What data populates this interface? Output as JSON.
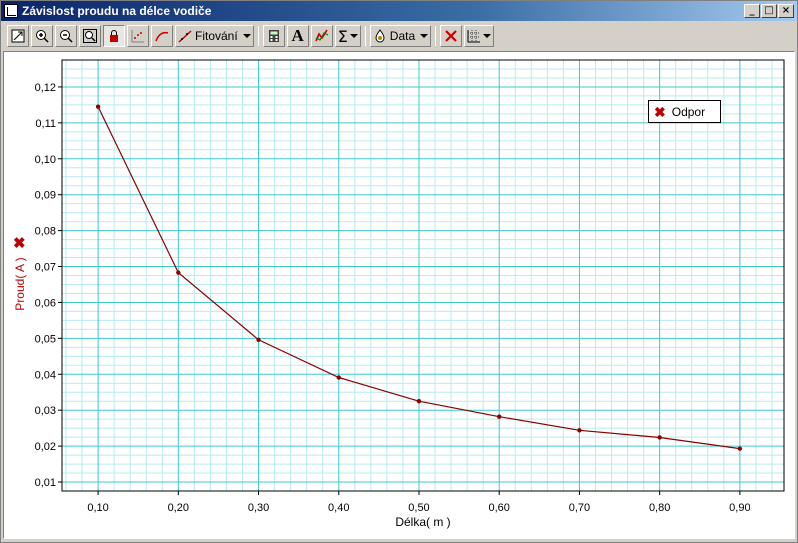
{
  "window": {
    "title": "Závislost proudu na délce vodiče",
    "buttons": {
      "minimize": "_",
      "maximize": "□",
      "close": "×"
    }
  },
  "toolbar": {
    "fit_label": "Fitování",
    "data_label": "Data",
    "sum_label": "Σ",
    "text_label": "A",
    "icons": [
      "resize-icon",
      "zoom-in-icon",
      "zoom-out-icon",
      "zoom-fit-icon",
      "lock-icon",
      "scatter-icon",
      "curve-icon",
      "fit-line-icon",
      "calculator-icon",
      "text-icon",
      "graph-icon",
      "sum-icon",
      "data-icon",
      "delete-icon",
      "grid-icon"
    ]
  },
  "chart_data": {
    "type": "line",
    "title": "",
    "xlabel": "Délka( m )",
    "ylabel": "Proud( A )",
    "xlim": [
      0.055,
      0.955
    ],
    "ylim": [
      0.0075,
      0.1275
    ],
    "xticks": [
      "0,10",
      "0,20",
      "0,30",
      "0,40",
      "0,50",
      "0,60",
      "0,70",
      "0,80",
      "0,90"
    ],
    "xtick_values": [
      0.1,
      0.2,
      0.3,
      0.4,
      0.5,
      0.6,
      0.7,
      0.8,
      0.9
    ],
    "yticks": [
      "0,01",
      "0,02",
      "0,03",
      "0,04",
      "0,05",
      "0,06",
      "0,07",
      "0,08",
      "0,09",
      "0,10",
      "0,11",
      "0,12"
    ],
    "ytick_values": [
      0.01,
      0.02,
      0.03,
      0.04,
      0.05,
      0.06,
      0.07,
      0.08,
      0.09,
      0.1,
      0.11,
      0.12
    ],
    "grid": true,
    "legend_position": "top-right",
    "series": [
      {
        "name": "Odpor",
        "color": "#8b0000",
        "x": [
          0.1,
          0.2,
          0.3,
          0.4,
          0.5,
          0.6,
          0.7,
          0.8,
          0.9
        ],
        "y": [
          0.1145,
          0.0683,
          0.0496,
          0.0391,
          0.0325,
          0.0282,
          0.0244,
          0.0224,
          0.0193
        ]
      }
    ],
    "colors": {
      "grid_major": "#40c8d0",
      "grid_minor": "#b8ecf0",
      "axis_label": "#c00000"
    }
  }
}
